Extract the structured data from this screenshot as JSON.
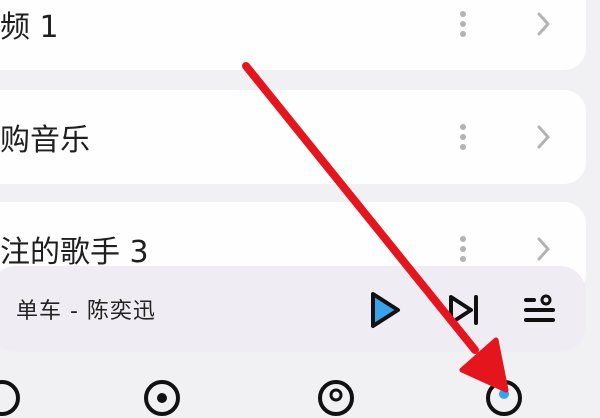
{
  "list": {
    "items": [
      {
        "label": "频 1"
      },
      {
        "label": "购音乐"
      },
      {
        "label": "注的歌手 3"
      }
    ]
  },
  "player": {
    "now_playing": "单车 - 陈奕迅",
    "controls": [
      "play-icon",
      "next-icon",
      "playlist-icon"
    ]
  },
  "bottom_nav": {
    "icons": [
      "nav-icon-1",
      "nav-icon-2",
      "nav-icon-3",
      "nav-icon-4"
    ]
  },
  "colors": {
    "accent": "#3aa2ea",
    "arrow": "#e5151d",
    "background": "#f1f1f4",
    "card": "#fefefe",
    "player_bg": "#efedf3"
  }
}
